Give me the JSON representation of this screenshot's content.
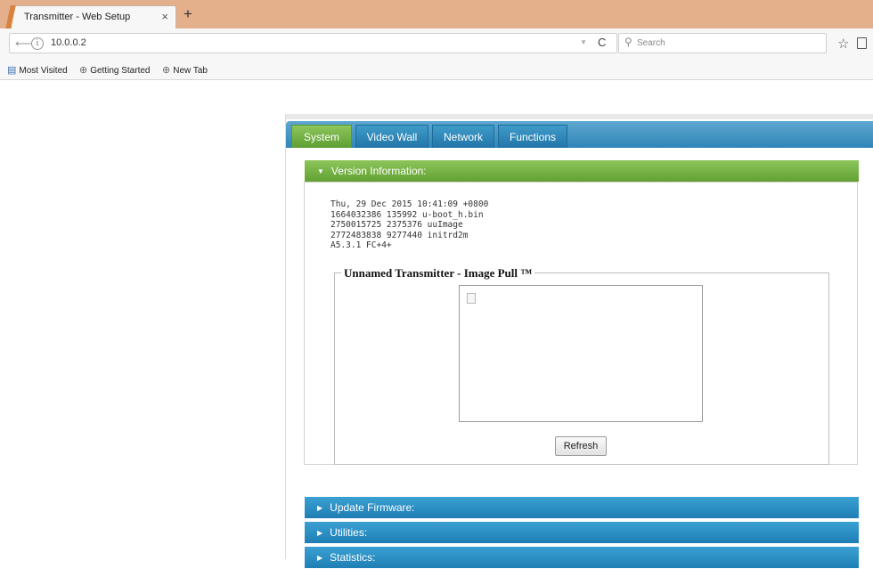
{
  "browser": {
    "tab_title": "Transmitter - Web Setup",
    "tab_close": "×",
    "new_tab": "+",
    "url": "10.0.0.2",
    "search_placeholder": "Search",
    "bookmarks": [
      "Most Visited",
      "Getting Started",
      "New Tab"
    ]
  },
  "page": {
    "tabs": [
      "System",
      "Video Wall",
      "Network",
      "Functions"
    ],
    "active_tab": "System",
    "version_section": {
      "title": "Version Information:",
      "lines": "Thu, 29 Dec 2015 10:41:09 +0800\n1664032386 135992 u-boot_h.bin\n2750015725 2375376 uuImage\n2772483838 9277440 initrd2m\nA5.3.1 FC+4+"
    },
    "image_pull": {
      "legend": "Unnamed Transmitter - Image Pull ™",
      "refresh_label": "Refresh"
    },
    "collapsed_sections": [
      "Update Firmware:",
      "Utilities:",
      "Statistics:"
    ]
  },
  "colors": {
    "tabstrip": "#e4b08c",
    "active_green": "#6aa83c",
    "header_blue": "#2a89bd"
  },
  "icons": [
    "back-arrow-icon",
    "info-icon",
    "reload-icon",
    "search-icon",
    "star-icon",
    "clipboard-icon",
    "bookmark-folder-icon",
    "globe-icon",
    "broken-image-icon"
  ]
}
